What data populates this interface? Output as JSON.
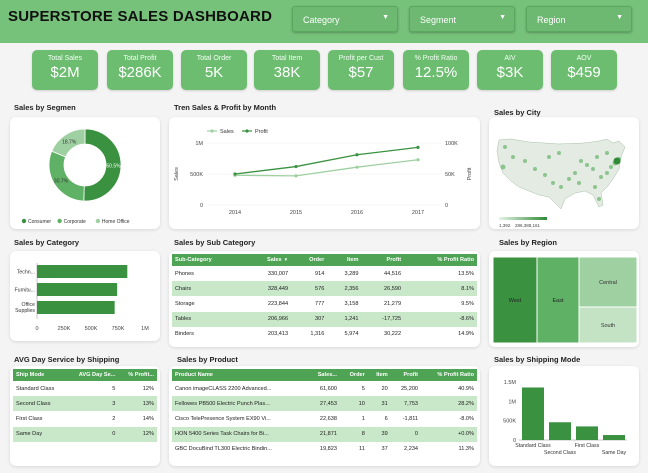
{
  "header": {
    "title": "SUPERSTORE SALES DASHBOARD",
    "filters": [
      {
        "label": "Category"
      },
      {
        "label": "Segment"
      },
      {
        "label": "Region"
      }
    ]
  },
  "kpis": [
    {
      "label": "Total Sales",
      "value": "$2M"
    },
    {
      "label": "Total Profit",
      "value": "$286K"
    },
    {
      "label": "Total Order",
      "value": "5K"
    },
    {
      "label": "Total Item",
      "value": "38K"
    },
    {
      "label": "Profit per Cust",
      "value": "$57"
    },
    {
      "label": "% Profit Ratio",
      "value": "12.5%"
    },
    {
      "label": "AIV",
      "value": "$3K"
    },
    {
      "label": "AOV",
      "value": "$459"
    }
  ],
  "sections": {
    "segment": "Sales by Segmen",
    "trend": "Tren Sales & Profit by Month",
    "city": "Sales by City",
    "category": "Sales by Category",
    "subcategory": "Sales by Sub Category",
    "region": "Sales by Region",
    "shipping_service": "AVG Day Service by Shipping",
    "product": "Sales by Product",
    "shipping_mode": "Sales by Shipping Mode"
  },
  "colors": {
    "dark": "#3a9140",
    "mid": "#5fb165",
    "light": "#9fd0a1",
    "header": "#76c27a",
    "kpi": "#6cbd70"
  },
  "city_map": {
    "scale_min": "1,392",
    "scale_max": "286,388,161"
  },
  "chart_data": [
    {
      "type": "pie",
      "id": "segment",
      "categories": [
        "Consumer",
        "Corporate",
        "Home Office"
      ],
      "values": [
        50.5,
        30.7,
        18.7
      ],
      "labels": [
        "50.5%",
        "30.7%",
        "18.7%"
      ]
    },
    {
      "type": "line",
      "id": "trend",
      "x": [
        "2014",
        "2015",
        "2016",
        "2017"
      ],
      "series": [
        {
          "name": "Sales",
          "values": [
            480000,
            470000,
            610000,
            730000
          ],
          "axis": "left"
        },
        {
          "name": "Profit",
          "values": [
            50000,
            62000,
            81000,
            93000
          ],
          "axis": "right"
        }
      ],
      "ylabel": "Sales",
      "y2label": "Profit",
      "yticks": [
        "0",
        "500K",
        "1M"
      ],
      "y2ticks": [
        "0",
        "50K",
        "100K"
      ],
      "ylim": [
        0,
        1000000
      ],
      "y2lim": [
        0,
        100000
      ]
    },
    {
      "type": "bar",
      "id": "category",
      "orientation": "horizontal",
      "categories": [
        "Techn...",
        "Furnitu...",
        "Office Supplies"
      ],
      "values": [
        836154,
        741999,
        719047
      ],
      "xticks": [
        "0",
        "250K",
        "500K",
        "750K",
        "1M"
      ],
      "xlim": [
        0,
        1000000
      ]
    },
    {
      "type": "bar",
      "id": "shipping_mode",
      "categories": [
        "Standard Class",
        "Second Class",
        "First Class",
        "Same Day"
      ],
      "values": [
        1358216,
        459194,
        351428,
        128363
      ],
      "yticks": [
        "0",
        "500K",
        "1M",
        "1.5M"
      ],
      "ylim": [
        0,
        1500000
      ]
    },
    {
      "type": "heatmap",
      "id": "region",
      "categories": [
        "West",
        "East",
        "Central",
        "South"
      ],
      "values": [
        725458,
        678781,
        501240,
        391722
      ]
    }
  ],
  "subcategory_table": {
    "columns": [
      "Sub-Category",
      "Sales",
      "Order",
      "Item",
      "Profit",
      "% Profit Ratio"
    ],
    "sort_arrow": "▼",
    "rows": [
      [
        "Phones",
        "330,007",
        "914",
        "3,289",
        "44,516",
        "13.5%"
      ],
      [
        "Chairs",
        "328,449",
        "576",
        "2,356",
        "26,590",
        "8.1%"
      ],
      [
        "Storage",
        "223,844",
        "777",
        "3,158",
        "21,279",
        "9.5%"
      ],
      [
        "Tables",
        "206,966",
        "307",
        "1,241",
        "-17,725",
        "-8.6%"
      ],
      [
        "Binders",
        "203,413",
        "1,316",
        "5,974",
        "30,222",
        "14.9%"
      ]
    ]
  },
  "shipping_table": {
    "columns": [
      "Ship Mode",
      "AVG Day Se...",
      "% Profit..."
    ],
    "rows": [
      [
        "Standard Class",
        "5",
        "12%"
      ],
      [
        "Second Class",
        "3",
        "13%"
      ],
      [
        "First Class",
        "2",
        "14%"
      ],
      [
        "Same Day",
        "0",
        "12%"
      ]
    ]
  },
  "product_table": {
    "columns": [
      "Product Name",
      "Sales...",
      "Order",
      "Item",
      "Profit",
      "% Profit Ratio"
    ],
    "rows": [
      [
        "Canon imageCLASS 2200 Advanced...",
        "61,600",
        "5",
        "20",
        "25,200",
        "40.9%"
      ],
      [
        "Fellowes PB500 Electric Punch Plas...",
        "27,453",
        "10",
        "31",
        "7,753",
        "28.2%"
      ],
      [
        "Cisco TelePresence System EX90 Vi...",
        "22,638",
        "1",
        "6",
        "-1,811",
        "-8.0%"
      ],
      [
        "HON 5400 Series Task Chairs for Bi...",
        "21,871",
        "8",
        "39",
        "0",
        "+0.0%"
      ],
      [
        "GBC DocuBind TL300 Electric Bindin...",
        "19,823",
        "11",
        "37",
        "2,234",
        "11.3%"
      ]
    ]
  }
}
